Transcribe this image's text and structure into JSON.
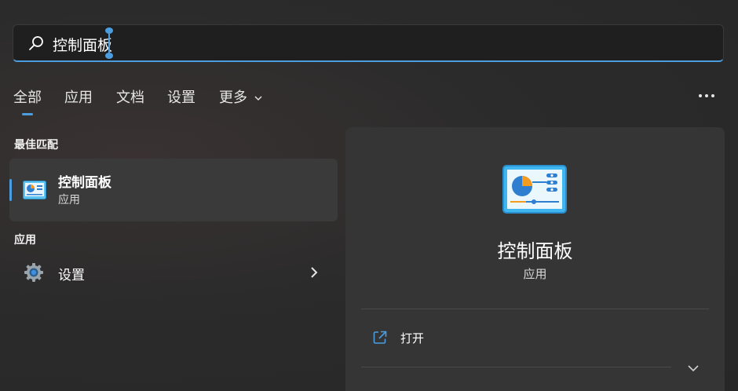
{
  "search": {
    "query": "控制面板"
  },
  "tabs": [
    {
      "label": "全部"
    },
    {
      "label": "应用"
    },
    {
      "label": "文档"
    },
    {
      "label": "设置"
    },
    {
      "label": "更多"
    }
  ],
  "results": {
    "best_match_title": "最佳匹配",
    "best_match": {
      "name": "控制面板",
      "type": "应用"
    },
    "apps_title": "应用",
    "apps": [
      {
        "name": "设置"
      }
    ]
  },
  "detail": {
    "name": "控制面板",
    "type": "应用",
    "actions": [
      {
        "label": "打开"
      }
    ]
  },
  "colors": {
    "accent": "#4c9de0",
    "background": "#2b2b2b",
    "panel": "#353535",
    "selected": "#3a3a3a"
  }
}
